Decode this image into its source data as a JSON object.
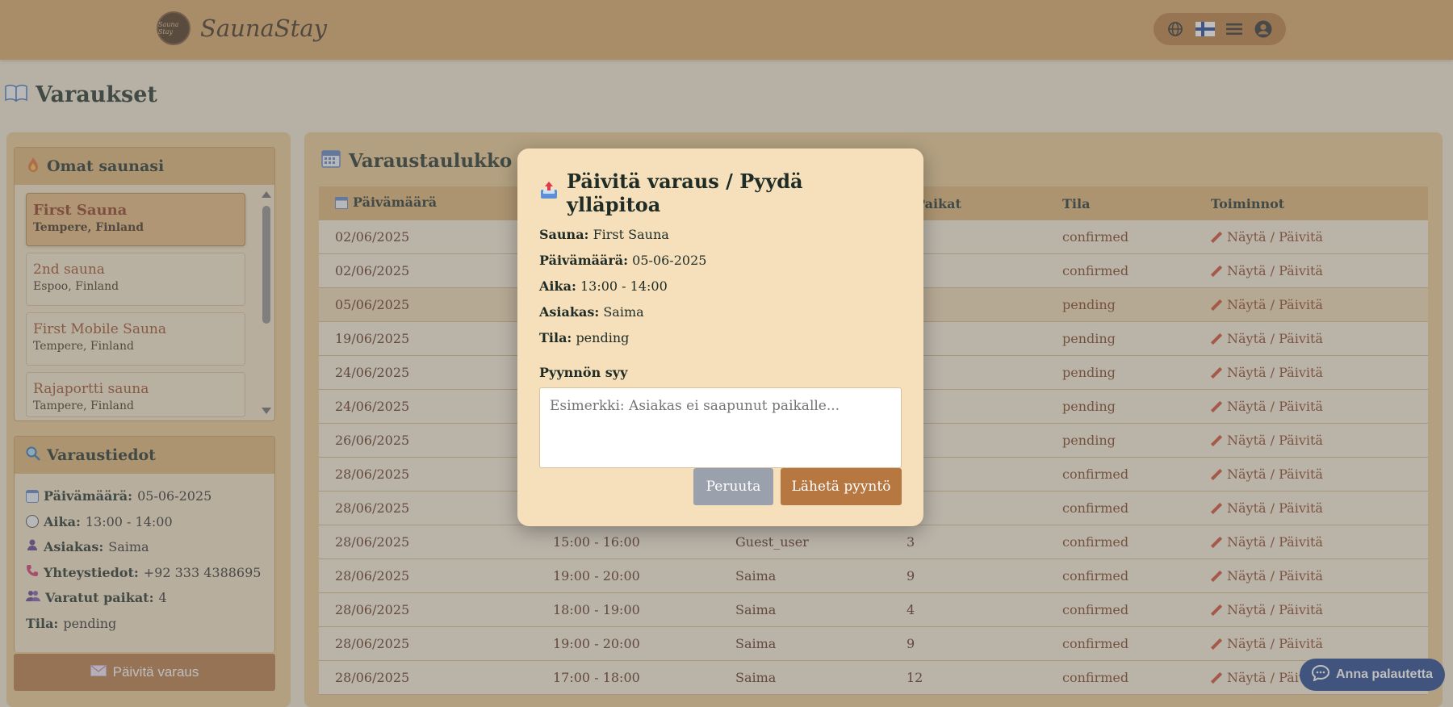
{
  "header": {
    "brand": "SaunaStay",
    "logo_text": "Sauna Stay"
  },
  "page": {
    "title": "Varaukset"
  },
  "sidebar": {
    "saunas_title": "Omat saunasi",
    "saunas": [
      {
        "name": "First Sauna",
        "location": "Tempere, Finland"
      },
      {
        "name": "2nd sauna",
        "location": "Espoo, Finland"
      },
      {
        "name": "First Mobile Sauna",
        "location": "Tempere, Finland"
      },
      {
        "name": "Rajaportti sauna",
        "location": "Tampere, Finland"
      }
    ],
    "details_title": "Varaustiedot",
    "details": {
      "date_label": "Päivämäärä:",
      "date": "05-06-2025",
      "time_label": "Aika:",
      "time": "13:00 - 14:00",
      "customer_label": "Asiakas:",
      "customer": "Saima",
      "contact_label": "Yhteystiedot:",
      "contact": "+92 333 4388695",
      "seats_label": "Varatut paikat:",
      "seats": "4",
      "status_label": "Tila:",
      "status": "pending"
    },
    "update_button": "Päivitä varaus"
  },
  "table": {
    "title": "Varaustaulukko",
    "headers": [
      "Päivämäärä",
      "",
      "",
      "Paikat",
      "Tila",
      "Toiminnot"
    ],
    "action_label": "Näytä / Päivitä",
    "rows": [
      {
        "date": "02/06/2025",
        "time": "",
        "customer": "",
        "seats": "",
        "status": "confirmed"
      },
      {
        "date": "02/06/2025",
        "time": "",
        "customer": "",
        "seats": "",
        "status": "confirmed"
      },
      {
        "date": "05/06/2025",
        "time": "",
        "customer": "",
        "seats": "",
        "status": "pending"
      },
      {
        "date": "19/06/2025",
        "time": "",
        "customer": "",
        "seats": "",
        "status": "pending"
      },
      {
        "date": "24/06/2025",
        "time": "",
        "customer": "",
        "seats": "",
        "status": "pending"
      },
      {
        "date": "24/06/2025",
        "time": "",
        "customer": "",
        "seats": "",
        "status": "pending"
      },
      {
        "date": "26/06/2025",
        "time": "",
        "customer": "",
        "seats": "",
        "status": "pending"
      },
      {
        "date": "28/06/2025",
        "time": "",
        "customer": "",
        "seats": "",
        "status": "confirmed"
      },
      {
        "date": "28/06/2025",
        "time": "",
        "customer": "",
        "seats": "",
        "status": "confirmed"
      },
      {
        "date": "28/06/2025",
        "time": "15:00 - 16:00",
        "customer": "Guest_user",
        "seats": "3",
        "status": "confirmed"
      },
      {
        "date": "28/06/2025",
        "time": "19:00 - 20:00",
        "customer": "Saima",
        "seats": "9",
        "status": "confirmed"
      },
      {
        "date": "28/06/2025",
        "time": "18:00 - 19:00",
        "customer": "Saima",
        "seats": "4",
        "status": "confirmed"
      },
      {
        "date": "28/06/2025",
        "time": "19:00 - 20:00",
        "customer": "Saima",
        "seats": "9",
        "status": "confirmed"
      },
      {
        "date": "28/06/2025",
        "time": "17:00 - 18:00",
        "customer": "Saima",
        "seats": "12",
        "status": "confirmed"
      }
    ]
  },
  "modal": {
    "title": "Päivitä varaus / Pyydä ylläpitoa",
    "sauna_label": "Sauna:",
    "sauna": "First Sauna",
    "date_label": "Päivämäärä:",
    "date": "05-06-2025",
    "time_label": "Aika:",
    "time": "13:00 - 14:00",
    "customer_label": "Asiakas:",
    "customer": "Saima",
    "status_label": "Tila:",
    "status": "pending",
    "reason_label": "Pyynnön syy",
    "reason_placeholder": "Esimerkki: Asiakas ei saapunut paikalle...",
    "cancel": "Peruuta",
    "send": "Lähetä pyyntö"
  },
  "feedback_button": "Anna palautetta"
}
